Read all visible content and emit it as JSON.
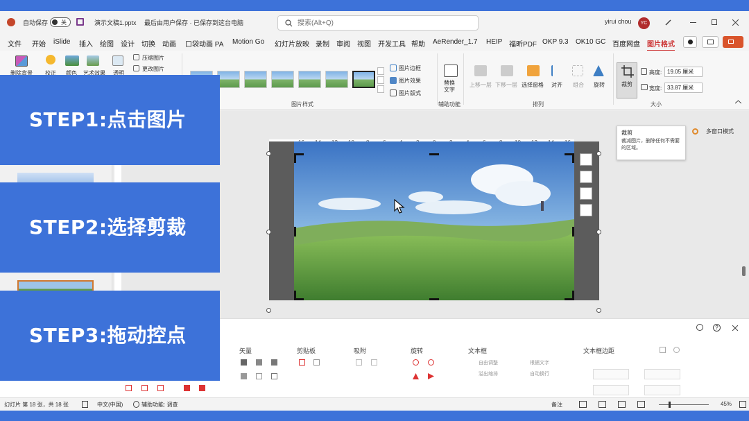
{
  "title_bar": {
    "autosave_label": "自动保存",
    "autosave_state": "关",
    "document_title": "演示文稿1.pptx",
    "save_status": "最后由用户保存 · 已保存到这台电脑",
    "search_placeholder": "搜索(Alt+Q)",
    "user_name": "yirui chou",
    "user_initials": "YC"
  },
  "menu_tabs": [
    "文件",
    "开始",
    "iSlide",
    "插入",
    "绘图",
    "设计",
    "切换",
    "动画",
    "口袋动画 PA",
    "Motion Go",
    "幻灯片放映",
    "录制",
    "审阅",
    "视图",
    "开发工具",
    "帮助",
    "AeRender_1.7",
    "HEIP",
    "福昕PDF",
    "OKP 9.3",
    "OK10 GC",
    "百度网盘",
    "图片格式"
  ],
  "active_tab": "图片格式",
  "ribbon": {
    "adjust": {
      "remove_bg": "删除背景",
      "corrections": "校正",
      "color": "颜色",
      "artistic": "艺术效果",
      "transparency": "透明",
      "compress": "压缩图片",
      "change": "更改图片"
    },
    "picture_styles_group": "图片样式",
    "border": "图片边框",
    "effects": "图片效果",
    "layout": "图片版式",
    "alt_text": "替换文字",
    "accessibility_group": "辅助功能",
    "arrange": {
      "bring_forward": "上移一层",
      "send_backward": "下移一层",
      "selection_pane": "选择窗格",
      "align": "对齐",
      "group": "组合",
      "rotate": "旋转"
    },
    "arrange_group": "排列",
    "crop": "裁剪",
    "height_label": "高度:",
    "height_value": "19.05 厘米",
    "width_label": "宽度:",
    "width_value": "33.87 厘米",
    "size_group": "大小"
  },
  "tooltip": {
    "title": "裁剪",
    "text": "裁减图片，删除任何不需要的区域。"
  },
  "multi_window": "多窗口模式",
  "ruler_labels": [
    "16",
    "14",
    "12",
    "10",
    "8",
    "6",
    "4",
    "2",
    "0",
    "2",
    "4",
    "6",
    "8",
    "10",
    "12",
    "14",
    "16"
  ],
  "lower_panel": {
    "vector": "矢量",
    "clipboard": "剪贴板",
    "snap": "吸附",
    "rotate": "旋转",
    "textbox": "文本框",
    "auto_fit": "自由调整",
    "overflow_shrink": "溢出缩排",
    "fit_text": "根据文字",
    "auto_wrap": "自动换行",
    "text_margin": "文本框边距"
  },
  "status_bar": {
    "slide_info": "幻灯片 第 18 张，共 18 张",
    "language": "中文(中国)",
    "accessibility": "辅助功能: 调查",
    "notes": "备注",
    "zoom": "45%"
  },
  "steps": [
    {
      "label": "STEP1:点击图片"
    },
    {
      "label": "STEP2:选择剪裁"
    },
    {
      "label": "STEP3:拖动控点"
    }
  ],
  "colors": {
    "banner_blue": "#3d72d9",
    "accent_red": "#cc3333",
    "avatar_red": "#b12c2c"
  }
}
